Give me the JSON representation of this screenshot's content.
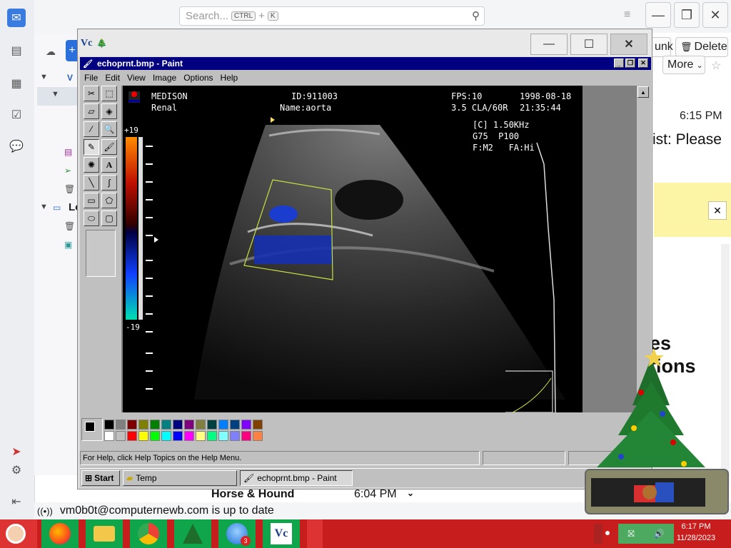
{
  "thunderbird": {
    "search_placeholder": "Search...",
    "search_kbd1": "CTRL",
    "search_plus": "+",
    "search_kbd2": "K",
    "btn_junk": "unk",
    "btn_delete": "Delete",
    "btn_more": "More",
    "time": "6:15 PM",
    "subject_fragment": "ist: Please",
    "heading_line1": "es",
    "heading_line2": "tions",
    "folder_v": "V",
    "folder_lo": "Lo",
    "message_row_sender": "Horse & Hound",
    "message_row_time": "6:04 PM",
    "status_text": "vm0b0t@computernewb.com is up to date"
  },
  "vnc": {
    "logo": "Vc"
  },
  "paint": {
    "title": "echoprnt.bmp - Paint",
    "menu": [
      "File",
      "Edit",
      "View",
      "Image",
      "Options",
      "Help"
    ],
    "help_text": "For Help, click Help Topics on the Help Menu.",
    "start_label": "Start",
    "task_temp": "Temp",
    "task_paint": "echoprnt.bmp - Paint"
  },
  "ultrasound": {
    "brand": "MEDISON",
    "mode": "Renal",
    "id": "ID:911003",
    "name": "Name:aorta",
    "fps": "FPS:10",
    "date": "1998-08-18",
    "probe": "3.5 CLA/60R",
    "clock": "21:35:44",
    "c_line": "[C] 1.50KHz",
    "g_line": "G75  P100",
    "f_line": "F:M2   FA:Hi",
    "scale_top": "+19",
    "scale_bottom": "-19"
  },
  "palette": [
    "#000000",
    "#808080",
    "#800000",
    "#808000",
    "#008000",
    "#008080",
    "#000080",
    "#800080",
    "#808040",
    "#004040",
    "#0080ff",
    "#004080",
    "#8000ff",
    "#804000",
    "#ffffff",
    "#c0c0c0",
    "#ff0000",
    "#ffff00",
    "#00ff00",
    "#00ffff",
    "#0000ff",
    "#ff00ff",
    "#ffff80",
    "#00ff80",
    "#80ffff",
    "#8080ff",
    "#ff0080",
    "#ff8040"
  ],
  "host_taskbar": {
    "time": "6:17 PM",
    "date": "11/28/2023",
    "badge": "3"
  }
}
